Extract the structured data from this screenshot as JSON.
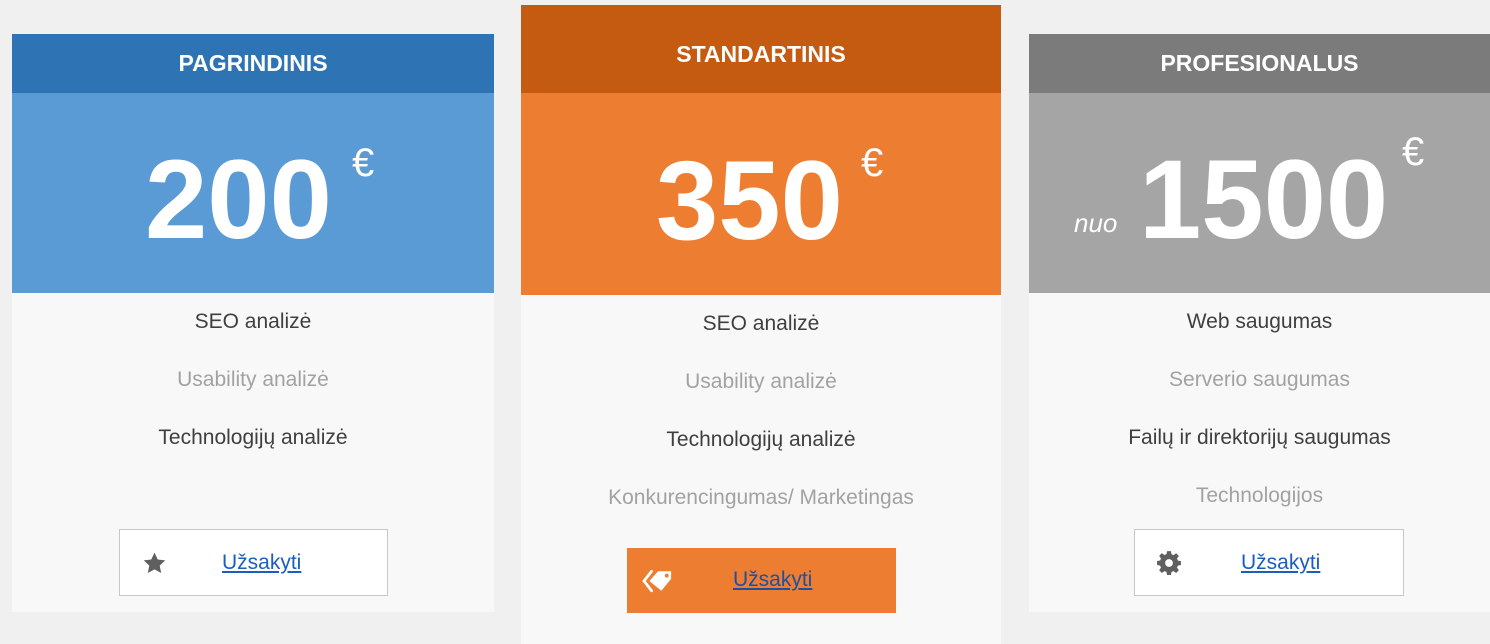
{
  "plans": [
    {
      "title": "PAGRINDINIS",
      "price": "200",
      "currency": "€",
      "features": [
        "SEO analizė",
        "Usability analizė",
        "Technologijų analizė"
      ],
      "button_label": "Užsakyti",
      "button_icon": "star-icon",
      "colors": {
        "header": "#2e74b5",
        "price": "#5b9bd5"
      }
    },
    {
      "title": "STANDARTINIS",
      "price": "350",
      "currency": "€",
      "features": [
        "SEO analizė",
        "Usability analizė",
        "Technologijų analizė",
        "Konkurencingumas/ Marketingas"
      ],
      "button_label": "Užsakyti",
      "button_icon": "tag-icon",
      "colors": {
        "header": "#c55a11",
        "price": "#ed7d31",
        "button": "#ed7d31"
      }
    },
    {
      "title": "PROFESIONALUS",
      "price_prefix": "nuo",
      "price": "1500",
      "currency": "€",
      "features": [
        "Web saugumas",
        "Serverio saugumas",
        "Failų ir direktorijų saugumas",
        "Technologijos"
      ],
      "button_label": "Užsakyti",
      "button_icon": "gear-icon",
      "colors": {
        "header": "#7b7b7b",
        "price": "#a5a5a5"
      }
    }
  ]
}
